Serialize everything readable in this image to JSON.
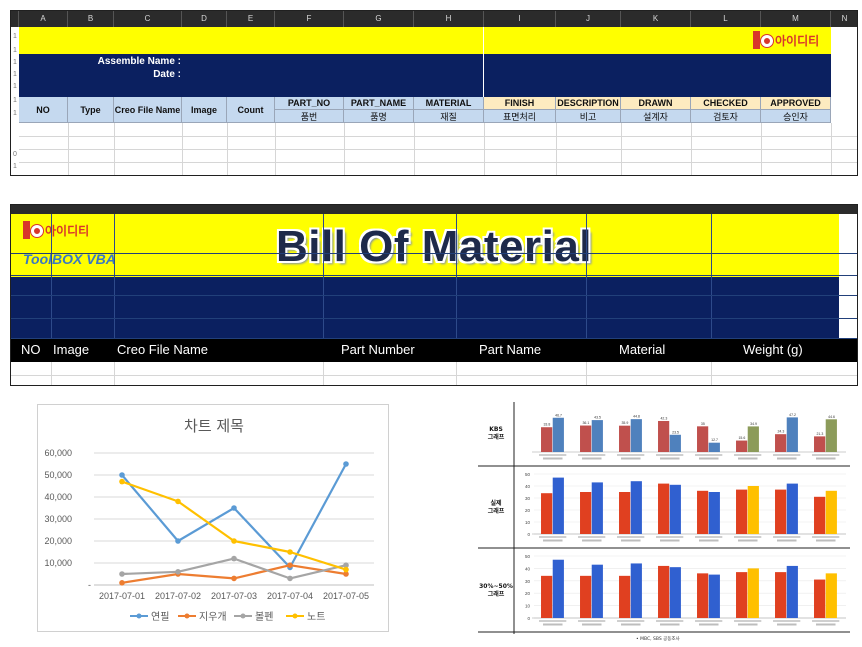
{
  "sheet_template": {
    "column_letters": [
      "A",
      "B",
      "C",
      "D",
      "E",
      "F",
      "G",
      "H",
      "I",
      "J",
      "K",
      "L",
      "M",
      "N"
    ],
    "assemble_name_label": "Assemble Name :",
    "date_label": "Date :",
    "logo_text": "아이디티",
    "headers_left": [
      "NO",
      "Type",
      "Creo File Name",
      "Image",
      "Count"
    ],
    "headers_en": [
      "PART_NO",
      "PART_NAME",
      "MATERIAL",
      "FINISH",
      "DESCRIPTION",
      "DRAWN",
      "CHECKED",
      "APPROVED"
    ],
    "headers_ko": [
      "품번",
      "품명",
      "재질",
      "표면처리",
      "비고",
      "설계자",
      "검토자",
      "승인자"
    ],
    "row_numbers": [
      "1",
      "1",
      "1",
      "1",
      "1",
      "1",
      "1",
      "0",
      "1"
    ]
  },
  "bom_template": {
    "logo_text": "아이디티",
    "toolbox_label": "ToolBOX VBA",
    "title": "Bill Of Material",
    "columns": [
      "NO",
      "Image",
      "Creo File Name",
      "Part Number",
      "Part Name",
      "Material",
      "Weight (g)"
    ]
  },
  "chart_data": [
    {
      "type": "line",
      "title": "차트 제목",
      "categories": [
        "2017-07-01",
        "2017-07-02",
        "2017-07-03",
        "2017-07-04",
        "2017-07-05"
      ],
      "ylim": [
        0,
        60000
      ],
      "ytick_labels": [
        "-",
        "10,000",
        "20,000",
        "30,000",
        "40,000",
        "50,000",
        "60,000"
      ],
      "grid": true,
      "legend_position": "bottom",
      "series": [
        {
          "name": "연필",
          "color": "#5b9bd5",
          "values": [
            50000,
            20000,
            35000,
            8000,
            55000
          ]
        },
        {
          "name": "지우개",
          "color": "#ed7d31",
          "values": [
            1000,
            5000,
            3000,
            9000,
            5000
          ]
        },
        {
          "name": "볼펜",
          "color": "#a5a5a5",
          "values": [
            5000,
            6000,
            12000,
            3000,
            9000
          ]
        },
        {
          "name": "노트",
          "color": "#ffc000",
          "values": [
            47000,
            38000,
            20000,
            15000,
            7000
          ]
        }
      ]
    },
    {
      "type": "bar",
      "title": "",
      "panel_label": "KBS 그래프",
      "category_count": 8,
      "series": [
        {
          "color": "#c0504d",
          "values": [
            33.8,
            36.1,
            35.9,
            42.3,
            35.0,
            15.6,
            24.3,
            21.3
          ]
        },
        {
          "color": "#4f81bd",
          "values": [
            46.7,
            43.5,
            44.8,
            23.5,
            12.7,
            34.9,
            47.2,
            44.6
          ]
        }
      ],
      "tick_colors_alt": [
        "#8c9b5a"
      ]
    },
    {
      "type": "bar",
      "title": "",
      "panel_label": "실제 그래프",
      "category_count": 8,
      "ylim": [
        0,
        50
      ],
      "ytick_labels": [
        "0",
        "10",
        "20",
        "30",
        "40",
        "50"
      ],
      "series": [
        {
          "color": "#e04020",
          "values": [
            34,
            35,
            35,
            42,
            36,
            37,
            37,
            31
          ]
        },
        {
          "color": "#3060d0",
          "values": [
            47,
            43,
            44,
            41,
            35,
            40,
            42,
            36
          ]
        }
      ]
    },
    {
      "type": "bar",
      "title": "",
      "panel_label": "30%~50% 그래프",
      "category_count": 8,
      "ylim": [
        0,
        50
      ],
      "ytick_labels": [
        "0",
        "10",
        "20",
        "30",
        "40",
        "50"
      ],
      "series": [
        {
          "color": "#e04020",
          "values": [
            34,
            34,
            34,
            42,
            36,
            37,
            37,
            31
          ]
        },
        {
          "color": "#3060d0",
          "values": [
            47,
            43,
            44,
            41,
            35,
            40,
            42,
            36
          ]
        }
      ]
    }
  ],
  "bar_collage_footnote": "• MBC, SBS 공동조사"
}
